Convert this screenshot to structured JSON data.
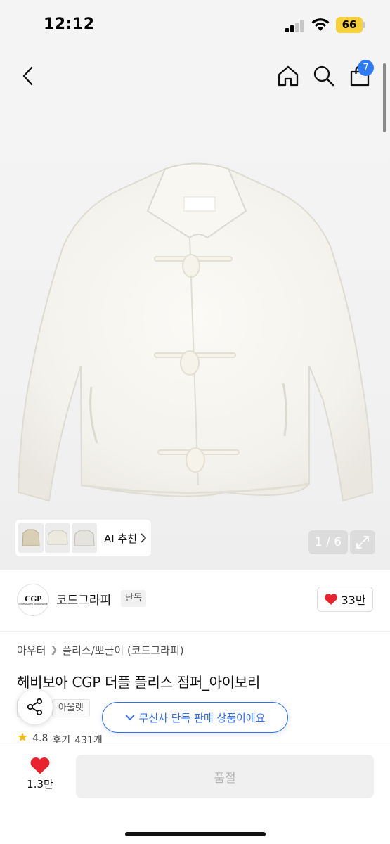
{
  "status_bar": {
    "time": "12:12",
    "battery": "66",
    "battery_color": "#f7d13a"
  },
  "header": {
    "back_icon": "chevron-left-icon",
    "home_icon": "home-icon",
    "search_icon": "search-icon",
    "cart_icon": "shopping-bag-icon",
    "cart_count": "7",
    "badge_color": "#2f7bf5"
  },
  "gallery": {
    "ai_recommend_label": "AI 추천",
    "page_counter": "1 / 6",
    "expand_icon": "expand-icon"
  },
  "brand": {
    "logo_text": "CGP",
    "logo_sub": "CODEGRAPHY WORLDWIDE",
    "name": "코드그라피",
    "tag": "단독",
    "like_count": "33만"
  },
  "product": {
    "breadcrumb": [
      "아우터",
      "플리스/뽀글이 (코드그라피)"
    ],
    "title": "헤비보아 CGP 더플 플리스 점퍼_아이보리",
    "tags": [
      "단독",
      "아울렛"
    ],
    "exclusive_notice": "무신사 단독 판매 상품이에요",
    "rating": "4.8",
    "review_label": "후기",
    "review_count": "431개"
  },
  "bottom_bar": {
    "wish_count": "1.3만",
    "buy_label": "품절",
    "accent": "#e8232e"
  }
}
